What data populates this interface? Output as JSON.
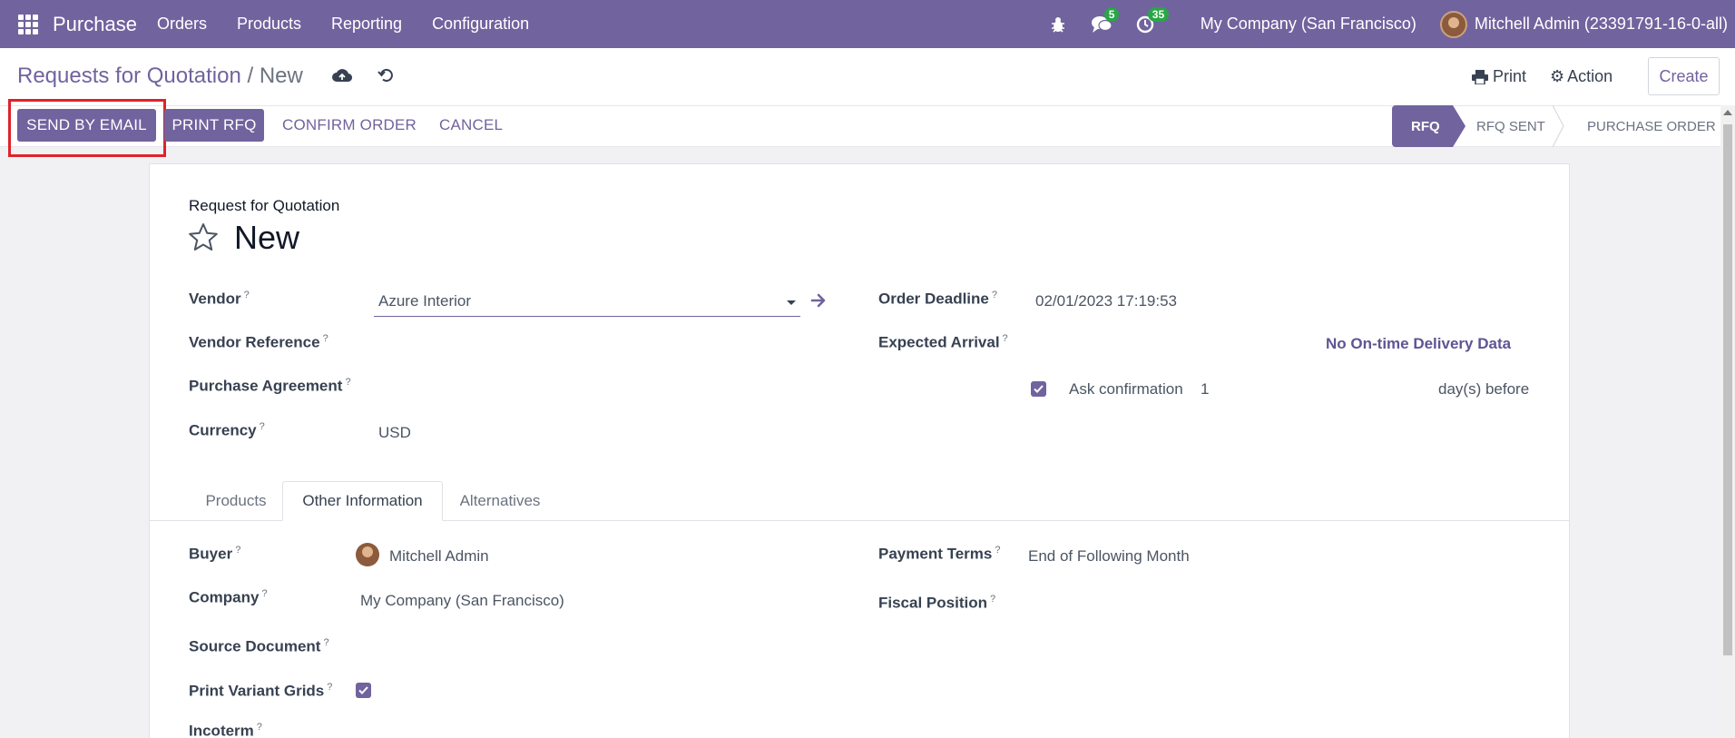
{
  "navbar": {
    "app_name": "Purchase",
    "menu": [
      "Orders",
      "Products",
      "Reporting",
      "Configuration"
    ],
    "messages_count": "5",
    "activities_count": "35",
    "company": "My Company (San Francisco)",
    "user": "Mitchell Admin (23391791-16-0-all)"
  },
  "control": {
    "breadcrumb_parent": "Requests for Quotation",
    "breadcrumb_sep": "/",
    "breadcrumb_current": "New",
    "print_label": "Print",
    "action_label": "Action",
    "create_label": "Create"
  },
  "statusbar": {
    "send_email": "SEND BY EMAIL",
    "print_rfq": "PRINT RFQ",
    "confirm_order": "CONFIRM ORDER",
    "cancel": "CANCEL",
    "stages": [
      "RFQ",
      "RFQ SENT",
      "PURCHASE ORDER"
    ]
  },
  "form": {
    "doc_type": "Request for Quotation",
    "title": "New",
    "help_mark": "?",
    "vendor_label": "Vendor",
    "vendor_value": "Azure Interior",
    "vendor_ref_label": "Vendor Reference",
    "agreement_label": "Purchase Agreement",
    "currency_label": "Currency",
    "currency_value": "USD",
    "deadline_label": "Order Deadline",
    "deadline_value": "02/01/2023 17:19:53",
    "arrival_label": "Expected Arrival",
    "ontime_text": "No On-time Delivery Data",
    "ask_confirmation_label": "Ask confirmation",
    "ask_confirmation_days": "1",
    "days_before": "day(s) before"
  },
  "tabs": [
    "Products",
    "Other Information",
    "Alternatives"
  ],
  "other_info": {
    "buyer_label": "Buyer",
    "buyer_value": "Mitchell Admin",
    "company_label": "Company",
    "company_value": "My Company (San Francisco)",
    "source_label": "Source Document",
    "variant_grids_label": "Print Variant Grids",
    "incoterm_label": "Incoterm",
    "payment_terms_label": "Payment Terms",
    "payment_terms_value": "End of Following Month",
    "fiscal_position_label": "Fiscal Position"
  },
  "colors": {
    "brand": "#71639e",
    "badge": "#28a745",
    "highlight": "#e0222a"
  }
}
